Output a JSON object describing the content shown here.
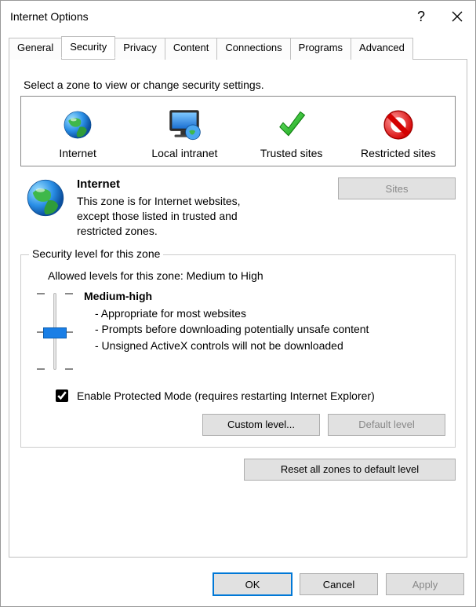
{
  "window": {
    "title": "Internet Options"
  },
  "tabs": [
    "General",
    "Security",
    "Privacy",
    "Content",
    "Connections",
    "Programs",
    "Advanced"
  ],
  "active_tab": "Security",
  "zone_instruction": "Select a zone to view or change security settings.",
  "zones": {
    "internet": "Internet",
    "local_intranet": "Local intranet",
    "trusted": "Trusted sites",
    "restricted": "Restricted sites"
  },
  "zone_detail": {
    "name": "Internet",
    "desc": "This zone is for Internet websites, except those listed in trusted and restricted zones.",
    "sites_label": "Sites"
  },
  "security": {
    "legend": "Security level for this zone",
    "allowed": "Allowed levels for this zone: Medium to High",
    "level_name": "Medium-high",
    "bullet1": "- Appropriate for most websites",
    "bullet2": "- Prompts before downloading potentially unsafe content",
    "bullet3": "- Unsigned ActiveX controls will not be downloaded",
    "protected_mode": "Enable Protected Mode (requires restarting Internet Explorer)",
    "custom_level": "Custom level...",
    "default_level": "Default level",
    "reset_all": "Reset all zones to default level"
  },
  "buttons": {
    "ok": "OK",
    "cancel": "Cancel",
    "apply": "Apply"
  }
}
